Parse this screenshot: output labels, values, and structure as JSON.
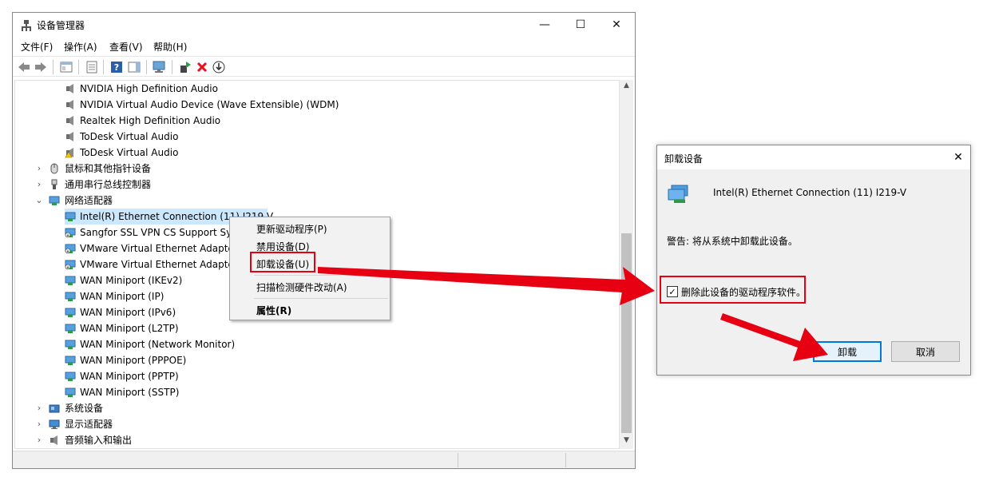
{
  "window": {
    "title": "设备管理器",
    "minimize_icon": "—",
    "maximize_icon": "☐",
    "close_icon": "✕"
  },
  "menu": [
    "文件(F)",
    "操作(A)",
    "查看(V)",
    "帮助(H)"
  ],
  "tree": {
    "audio_children": [
      "NVIDIA High Definition Audio",
      "NVIDIA Virtual Audio Device (Wave Extensible) (WDM)",
      "Realtek High Definition Audio",
      "ToDesk Virtual Audio",
      "ToDesk Virtual Audio"
    ],
    "mice": "鼠标和其他指针设备",
    "usb": "通用串行总线控制器",
    "network": "网络适配器",
    "network_children": [
      "Intel(R) Ethernet Connection (11) I219-V",
      "Sangfor SSL VPN CS Support Sy",
      "VMware Virtual Ethernet Adapte",
      "VMware Virtual Ethernet Adapte",
      "WAN Miniport (IKEv2)",
      "WAN Miniport (IP)",
      "WAN Miniport (IPv6)",
      "WAN Miniport (L2TP)",
      "WAN Miniport (Network Monitor)",
      "WAN Miniport (PPPOE)",
      "WAN Miniport (PPTP)",
      "WAN Miniport (SSTP)"
    ],
    "system": "系统设备",
    "display": "显示适配器",
    "audio_io": "音频输入和输出"
  },
  "context_menu": {
    "update_driver": "更新驱动程序(P)",
    "disable": "禁用设备(D)",
    "uninstall": "卸载设备(U)",
    "scan": "扫描检测硬件改动(A)",
    "properties": "属性(R)"
  },
  "dialog": {
    "title": "卸载设备",
    "close_icon": "✕",
    "device_name": "Intel(R) Ethernet Connection (11) I219-V",
    "warning": "警告: 将从系统中卸载此设备。",
    "checkbox_label": "删除此设备的驱动程序软件。",
    "checkbox_checked": true,
    "ok_label": "卸载",
    "cancel_label": "取消"
  },
  "colors": {
    "highlight_red": "#e60012",
    "accent_blue": "#0078d7",
    "selection": "#cce8ff"
  }
}
